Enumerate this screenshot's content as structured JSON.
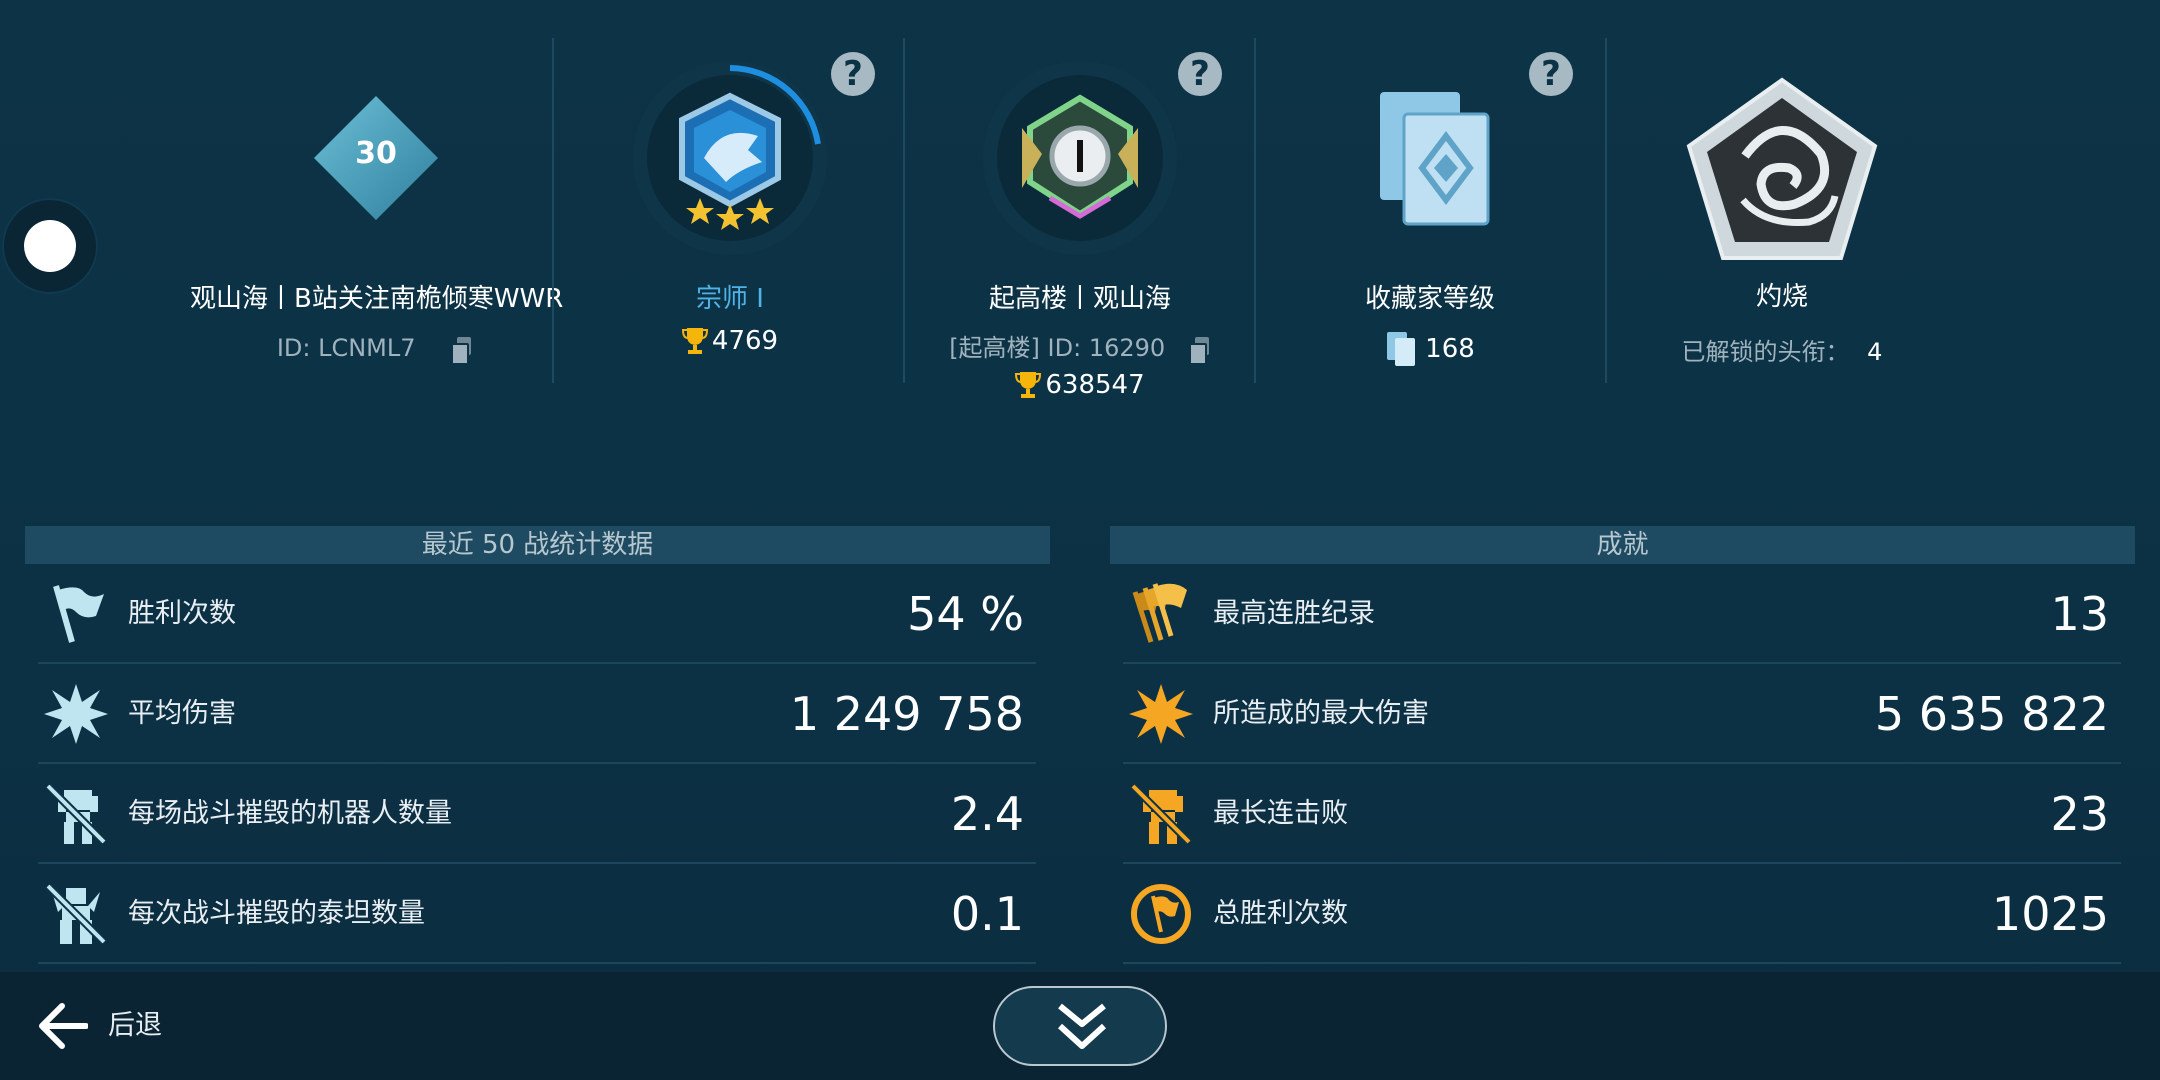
{
  "profile": {
    "level": "30",
    "name": "观山海丨B站关注南桅倾寒WWR",
    "id_text": "ID: LCNML7"
  },
  "rank": {
    "name": "宗师 I",
    "trophies": "4769",
    "help": "?"
  },
  "clan": {
    "name": "起高楼丨观山海",
    "id_text": "[起高楼] ID: 16290",
    "trophies": "638547",
    "help": "?"
  },
  "collector": {
    "name": "收藏家等级",
    "value": "168",
    "help": "?"
  },
  "title": {
    "name": "灼烧",
    "unlocked_label": "已解锁的头衔：",
    "unlocked_value": "4"
  },
  "stats": {
    "header": "最近 50 战统计数据",
    "rows": [
      {
        "label": "胜利次数",
        "value": "54 %",
        "icon": "victory-flag-icon"
      },
      {
        "label": "平均伤害",
        "value": "1 249 758",
        "icon": "damage-burst-icon"
      },
      {
        "label": "每场战斗摧毁的机器人数量",
        "value": "2.4",
        "icon": "destroyed-robot-icon"
      },
      {
        "label": "每次战斗摧毁的泰坦数量",
        "value": "0.1",
        "icon": "destroyed-titan-icon"
      }
    ]
  },
  "achievements": {
    "header": "成就",
    "rows": [
      {
        "label": "最高连胜纪录",
        "value": "13",
        "icon": "win-streak-flags-icon"
      },
      {
        "label": "所造成的最大伤害",
        "value": "5 635 822",
        "icon": "max-damage-burst-icon"
      },
      {
        "label": "最长连击败",
        "value": "23",
        "icon": "kill-streak-robot-icon"
      },
      {
        "label": "总胜利次数",
        "value": "1025",
        "icon": "total-wins-flag-icon"
      }
    ]
  },
  "bottom": {
    "back_label": "后退"
  },
  "colors": {
    "background": "#0c3245",
    "panel_header": "#1e4b61",
    "rank_text": "#4fb3e8",
    "stats_icon": "#bfe6f0",
    "achievement_icon": "#f5a623",
    "trophy": "#f5b50a"
  }
}
